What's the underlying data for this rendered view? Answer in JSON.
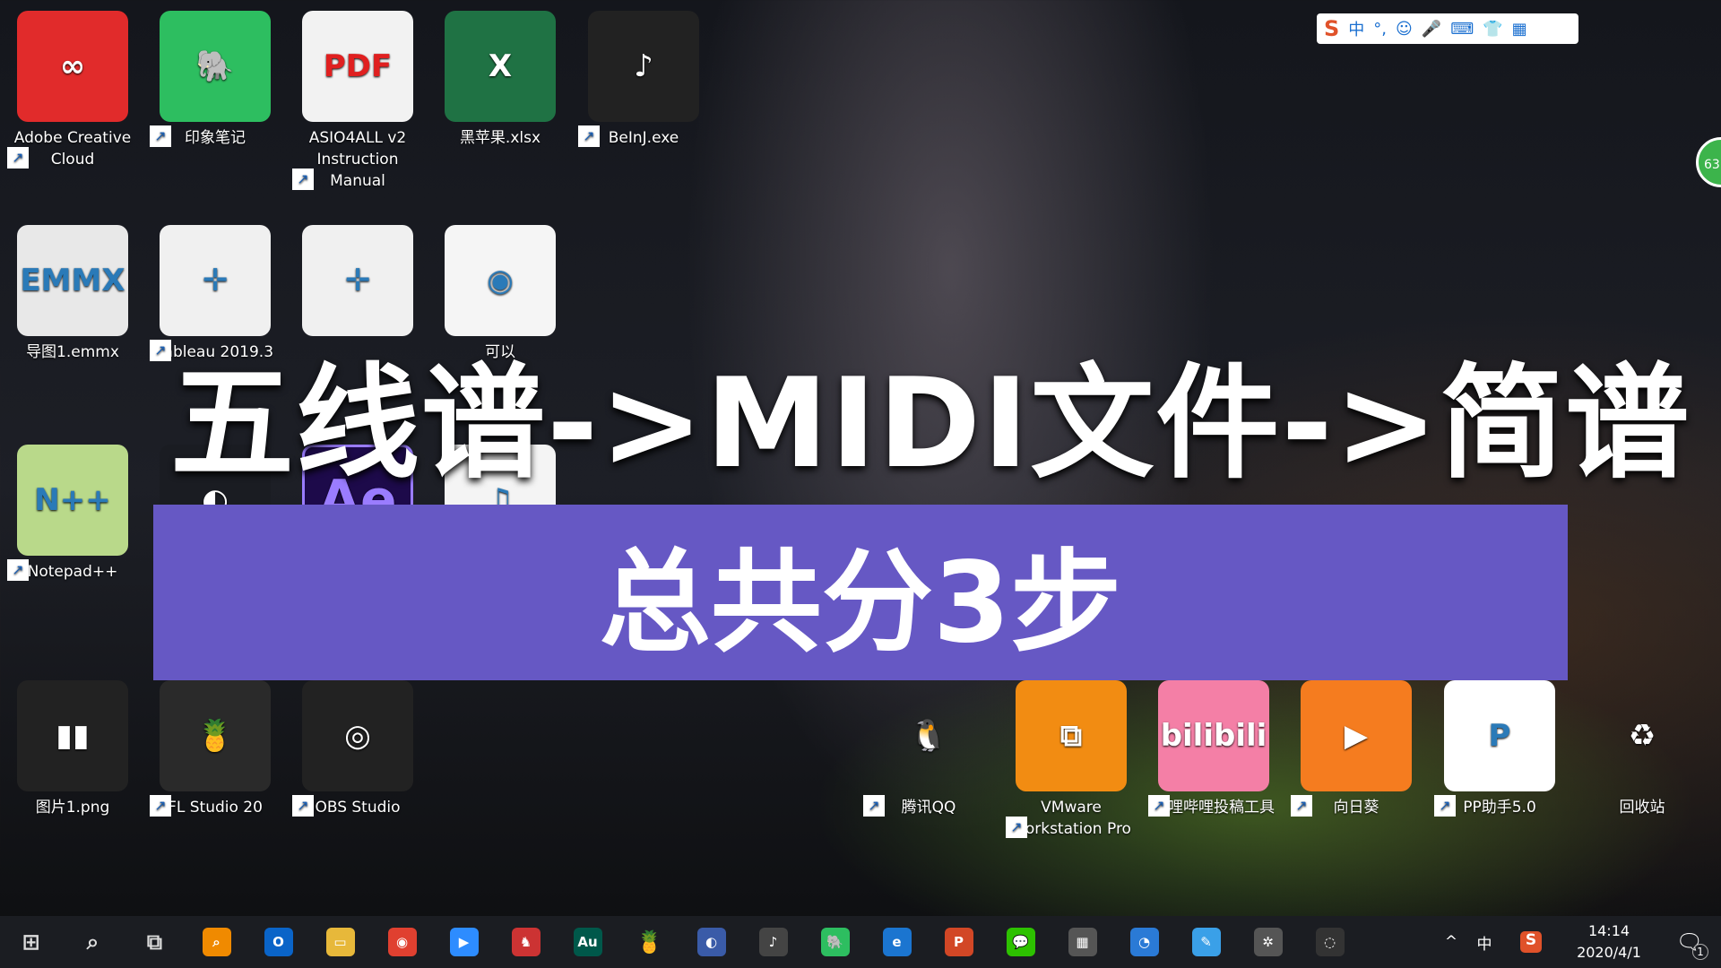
{
  "desktop_icons": [
    {
      "label": "Adobe Creative Cloud",
      "glyph": "∞",
      "color": "#e12b2b",
      "shortcut": true
    },
    {
      "label": "印象笔记",
      "glyph": "🐘",
      "color": "#2dbe60",
      "shortcut": true
    },
    {
      "label": "ASIO4ALL v2 Instruction Manual",
      "glyph": "PDF",
      "color": "#f2f2f2",
      "shortcut": true
    },
    {
      "label": "黑苹果.xlsx",
      "glyph": "X",
      "color": "#1f7244",
      "shortcut": false
    },
    {
      "label": "BeInJ.exe",
      "glyph": "♪",
      "color": "#222",
      "shortcut": true
    },
    {
      "label": "导图1.emmx",
      "glyph": "EMMX",
      "color": "#e8e8e8",
      "shortcut": false
    },
    {
      "label": "Tableau 2019.3",
      "glyph": "✛",
      "color": "#f0f0f0",
      "shortcut": true
    },
    {
      "label": "",
      "glyph": "✛",
      "color": "#f0f0f0",
      "shortcut": false
    },
    {
      "label": "可以",
      "glyph": "◉",
      "color": "#f5f5f5",
      "shortcut": false
    },
    {
      "label": "Notepad++",
      "glyph": "N++",
      "color": "#b9d98a",
      "shortcut": true
    },
    {
      "label": "",
      "glyph": "◐",
      "color": "#1a1c22",
      "shortcut": false
    },
    {
      "label": "",
      "glyph": "Ae",
      "color": "#1d0a4a",
      "shortcut": false
    },
    {
      "label": "",
      "glyph": "♫",
      "color": "#f4f4f4",
      "shortcut": false
    },
    {
      "label": "图片1.png",
      "glyph": "▮▮",
      "color": "#222",
      "shortcut": false
    },
    {
      "label": "FL Studio 20",
      "glyph": "🍍",
      "color": "#2a2a2a",
      "shortcut": true
    },
    {
      "label": "OBS Studio",
      "glyph": "◎",
      "color": "#222",
      "shortcut": true
    },
    {
      "label": "腾讯QQ",
      "glyph": "🐧",
      "color": "transparent",
      "shortcut": true
    },
    {
      "label": "VMware Workstation Pro",
      "glyph": "⧉",
      "color": "#f28c12",
      "shortcut": true
    },
    {
      "label": "哔哩哔哩投稿工具",
      "glyph": "bilibili",
      "color": "#f47fa6",
      "shortcut": true
    },
    {
      "label": "向日葵",
      "glyph": "▶",
      "color": "#f57c1f",
      "shortcut": true
    },
    {
      "label": "PP助手5.0",
      "glyph": "P",
      "color": "#ffffff",
      "shortcut": true
    },
    {
      "label": "回收站",
      "glyph": "♻",
      "color": "transparent",
      "shortcut": false
    }
  ],
  "overlay": {
    "title": "五线谱->MIDI文件->简谱",
    "banner": "总共分3步",
    "banner_color": "#6658c4"
  },
  "ime_toolbar": {
    "items": [
      "S",
      "中",
      "°,",
      "☺",
      "🎤",
      "⌨",
      "👕",
      "▦"
    ]
  },
  "floating_badge": "63",
  "taskbar": {
    "apps": [
      {
        "glyph": "⊞",
        "c": ""
      },
      {
        "glyph": "⌕",
        "c": ""
      },
      {
        "glyph": "⧉",
        "c": ""
      },
      {
        "glyph": "⌕",
        "c": "#f08a00"
      },
      {
        "glyph": "O",
        "c": "#0a64c8"
      },
      {
        "glyph": "▭",
        "c": "#e7b83a"
      },
      {
        "glyph": "◉",
        "c": "#e04030"
      },
      {
        "glyph": "▶",
        "c": "#2d8cff"
      },
      {
        "glyph": "♞",
        "c": "#c33"
      },
      {
        "glyph": "Au",
        "c": "#00584a"
      },
      {
        "glyph": "🍍",
        "c": ""
      },
      {
        "glyph": "◐",
        "c": "#3a5ba8"
      },
      {
        "glyph": "♪",
        "c": "#444"
      },
      {
        "glyph": "🐘",
        "c": "#2dbe60"
      },
      {
        "glyph": "e",
        "c": "#1b75d0"
      },
      {
        "glyph": "P",
        "c": "#d24726"
      },
      {
        "glyph": "💬",
        "c": "#2dc100"
      },
      {
        "glyph": "▦",
        "c": "#555"
      },
      {
        "glyph": "◔",
        "c": "#2a7ad6"
      },
      {
        "glyph": "✎",
        "c": "#3aa0e8"
      },
      {
        "glyph": "✲",
        "c": "#555"
      },
      {
        "glyph": "◌",
        "c": "#333"
      }
    ],
    "tray": {
      "chevron": "^",
      "ime": "中",
      "sogou": "S",
      "time": "14:14",
      "date": "2020/4/1",
      "notifications": "1"
    }
  }
}
